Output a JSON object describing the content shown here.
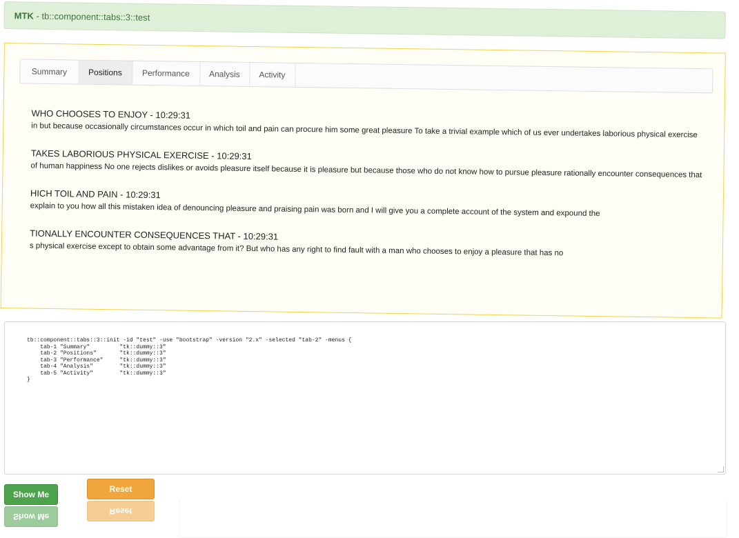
{
  "header": {
    "brand": "MTK",
    "title": "tb::component::tabs::3::test"
  },
  "tabs": [
    {
      "label": "Summary",
      "active": false
    },
    {
      "label": "Positions",
      "active": true
    },
    {
      "label": "Performance",
      "active": false
    },
    {
      "label": "Analysis",
      "active": false
    },
    {
      "label": "Activity",
      "active": false
    }
  ],
  "entries": [
    {
      "title": "WHO CHOOSES TO ENJOY - 10:29:31",
      "body": "in but because occasionally circumstances occur in which toil and pain can procure him some great pleasure To take a trivial example which of us ever undertakes laborious physical exercise"
    },
    {
      "title": "TAKES LABORIOUS PHYSICAL EXERCISE - 10:29:31",
      "body": "of human happiness No one rejects dislikes or avoids pleasure itself because it is pleasure but because those who do not know how to pursue pleasure rationally encounter consequences that"
    },
    {
      "title": "HICH TOIL AND PAIN - 10:29:31",
      "body": "explain to you how all this mistaken idea of denouncing pleasure and praising pain was born and I will give you a complete account of the system and expound the"
    },
    {
      "title": "TIONALLY ENCOUNTER CONSEQUENCES THAT - 10:29:31",
      "body": "s physical exercise except to obtain some advantage from it? But who has any right to find fault with a man who chooses to enjoy a pleasure that has no"
    }
  ],
  "code": "tb::component::tabs::3::init -id \"test\" -use \"bootstrap\" -version \"2.x\" -selected \"tab-2\" -menus {\n    tab-1 \"Summary\"         \"tk::dummy::3\"\n    tab-2 \"Positions\"       \"tk::dummy::3\"\n    tab-3 \"Performance\"     \"tk::dummy::3\"\n    tab-4 \"Analysis\"        \"tk::dummy::3\"\n    tab-5 \"Activity\"        \"tk::dummy::3\"\n}",
  "buttons": {
    "show": "Show Me",
    "reset": "Reset"
  },
  "colors": {
    "header_bg": "#dff0d8",
    "header_text": "#3c763d",
    "panel_border": "#f0d44a",
    "show_button": "#4ca34c",
    "reset_button": "#f0a63c"
  }
}
